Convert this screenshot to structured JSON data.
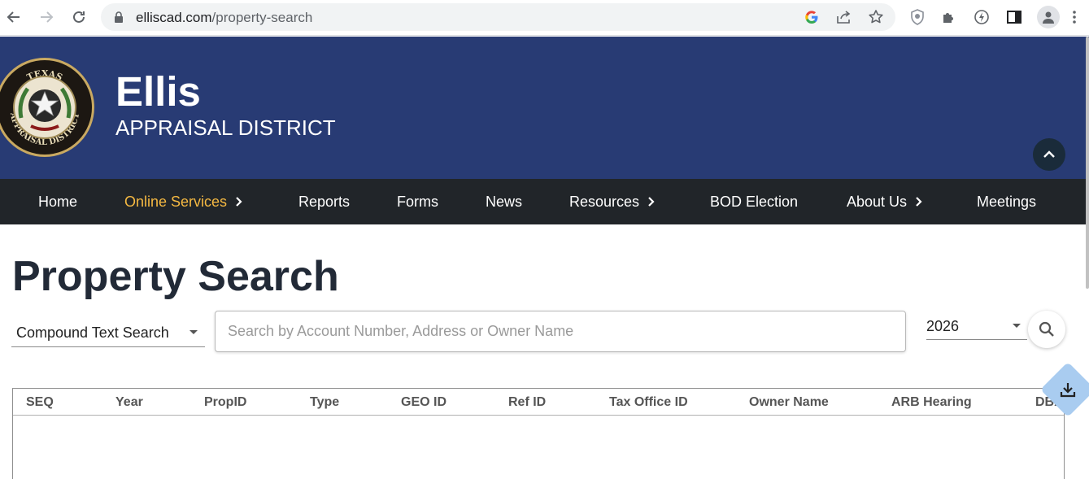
{
  "browser": {
    "url_domain": "elliscad.com",
    "url_path": "/property-search",
    "icons": [
      "back-icon",
      "forward-icon",
      "reload-icon",
      "lock-icon",
      "google-icon",
      "share-icon",
      "bookmark-star-icon",
      "shield-extension-icon",
      "puzzle-extension-icon",
      "lightning-extension-icon",
      "side-panel-icon",
      "profile-icon",
      "menu-kebab-icon"
    ]
  },
  "site": {
    "title": "Ellis",
    "subtitle": "APPRAISAL DISTRICT",
    "seal_text_top": "TEXAS",
    "seal_text_bottom": "APPRAISAL DISTRICT",
    "header_color": "#283b74",
    "nav_color": "#212529",
    "active_color": "#f5b942"
  },
  "nav": {
    "items": [
      {
        "label": "Home"
      },
      {
        "label": "Online Services"
      },
      {
        "label": "Reports"
      },
      {
        "label": "Forms"
      },
      {
        "label": "News"
      },
      {
        "label": "Resources"
      },
      {
        "label": "BOD Election"
      },
      {
        "label": "About Us"
      },
      {
        "label": "Meetings"
      }
    ]
  },
  "page": {
    "title": "Property Search"
  },
  "search": {
    "mode_selected": "Compound Text Search",
    "placeholder": "Search by Account Number, Address or Owner Name",
    "value": "",
    "year_selected": "2026"
  },
  "table": {
    "columns": [
      "SEQ",
      "Year",
      "PropID",
      "Type",
      "GEO ID",
      "Ref ID",
      "Tax Office ID",
      "Owner Name",
      "ARB Hearing",
      "DBA"
    ],
    "rows": []
  }
}
